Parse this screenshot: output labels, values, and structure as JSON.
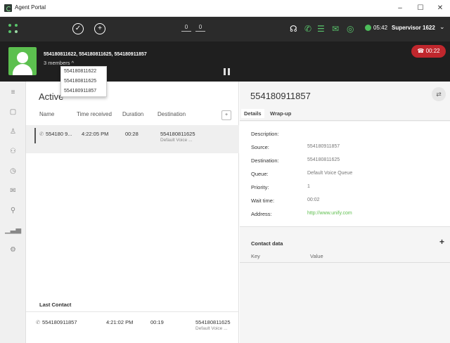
{
  "app": {
    "title": "Agent Portal"
  },
  "window": {
    "minimize": "–",
    "maximize": "☐",
    "close": "✕"
  },
  "toolbar": {
    "dial_digits": [
      "0",
      "0"
    ],
    "time": "05:42",
    "user": "Supervisor 1622",
    "status_color": "#4cbd5a"
  },
  "call": {
    "parties": "554180811622, 554180811625, 554180911857",
    "members": "3 members ^",
    "duration": "☎ 00:22",
    "hangup_color": "#c0272d",
    "member_list": [
      "554180811622",
      "554180811625",
      "554180911857"
    ]
  },
  "active": {
    "title": "Active",
    "columns": [
      "Name",
      "Time received",
      "Duration",
      "Destination"
    ],
    "add_label": "+",
    "row": {
      "name": "554180 9...",
      "time": "4:22:05 PM",
      "duration": "00:28",
      "destination": "554180811625",
      "sub": "Default Voice ..."
    }
  },
  "last_contact": {
    "title": "Last Contact",
    "row": {
      "name": "554180911857",
      "time": "4:21:02 PM",
      "duration": "00:19",
      "destination": "554180811625",
      "sub": "Default Voice ..."
    }
  },
  "detail": {
    "title": "554180911857",
    "tabs": [
      "Details",
      "Wrap-up"
    ],
    "fields": [
      {
        "label": "Description:",
        "value": ""
      },
      {
        "label": "Source:",
        "value": "554180911857"
      },
      {
        "label": "Destination:",
        "value": "554180811625"
      },
      {
        "label": "Queue:",
        "value": "Default Voice Queue"
      },
      {
        "label": "Priority:",
        "value": "1"
      },
      {
        "label": "Wait time:",
        "value": "00:02"
      },
      {
        "label": "Address:",
        "value": "http://www.unify.com"
      }
    ],
    "contact_title": "Contact data",
    "contact_add": "+",
    "contact_columns": [
      "Key",
      "Value"
    ],
    "link_color": "#5fbf4f"
  }
}
